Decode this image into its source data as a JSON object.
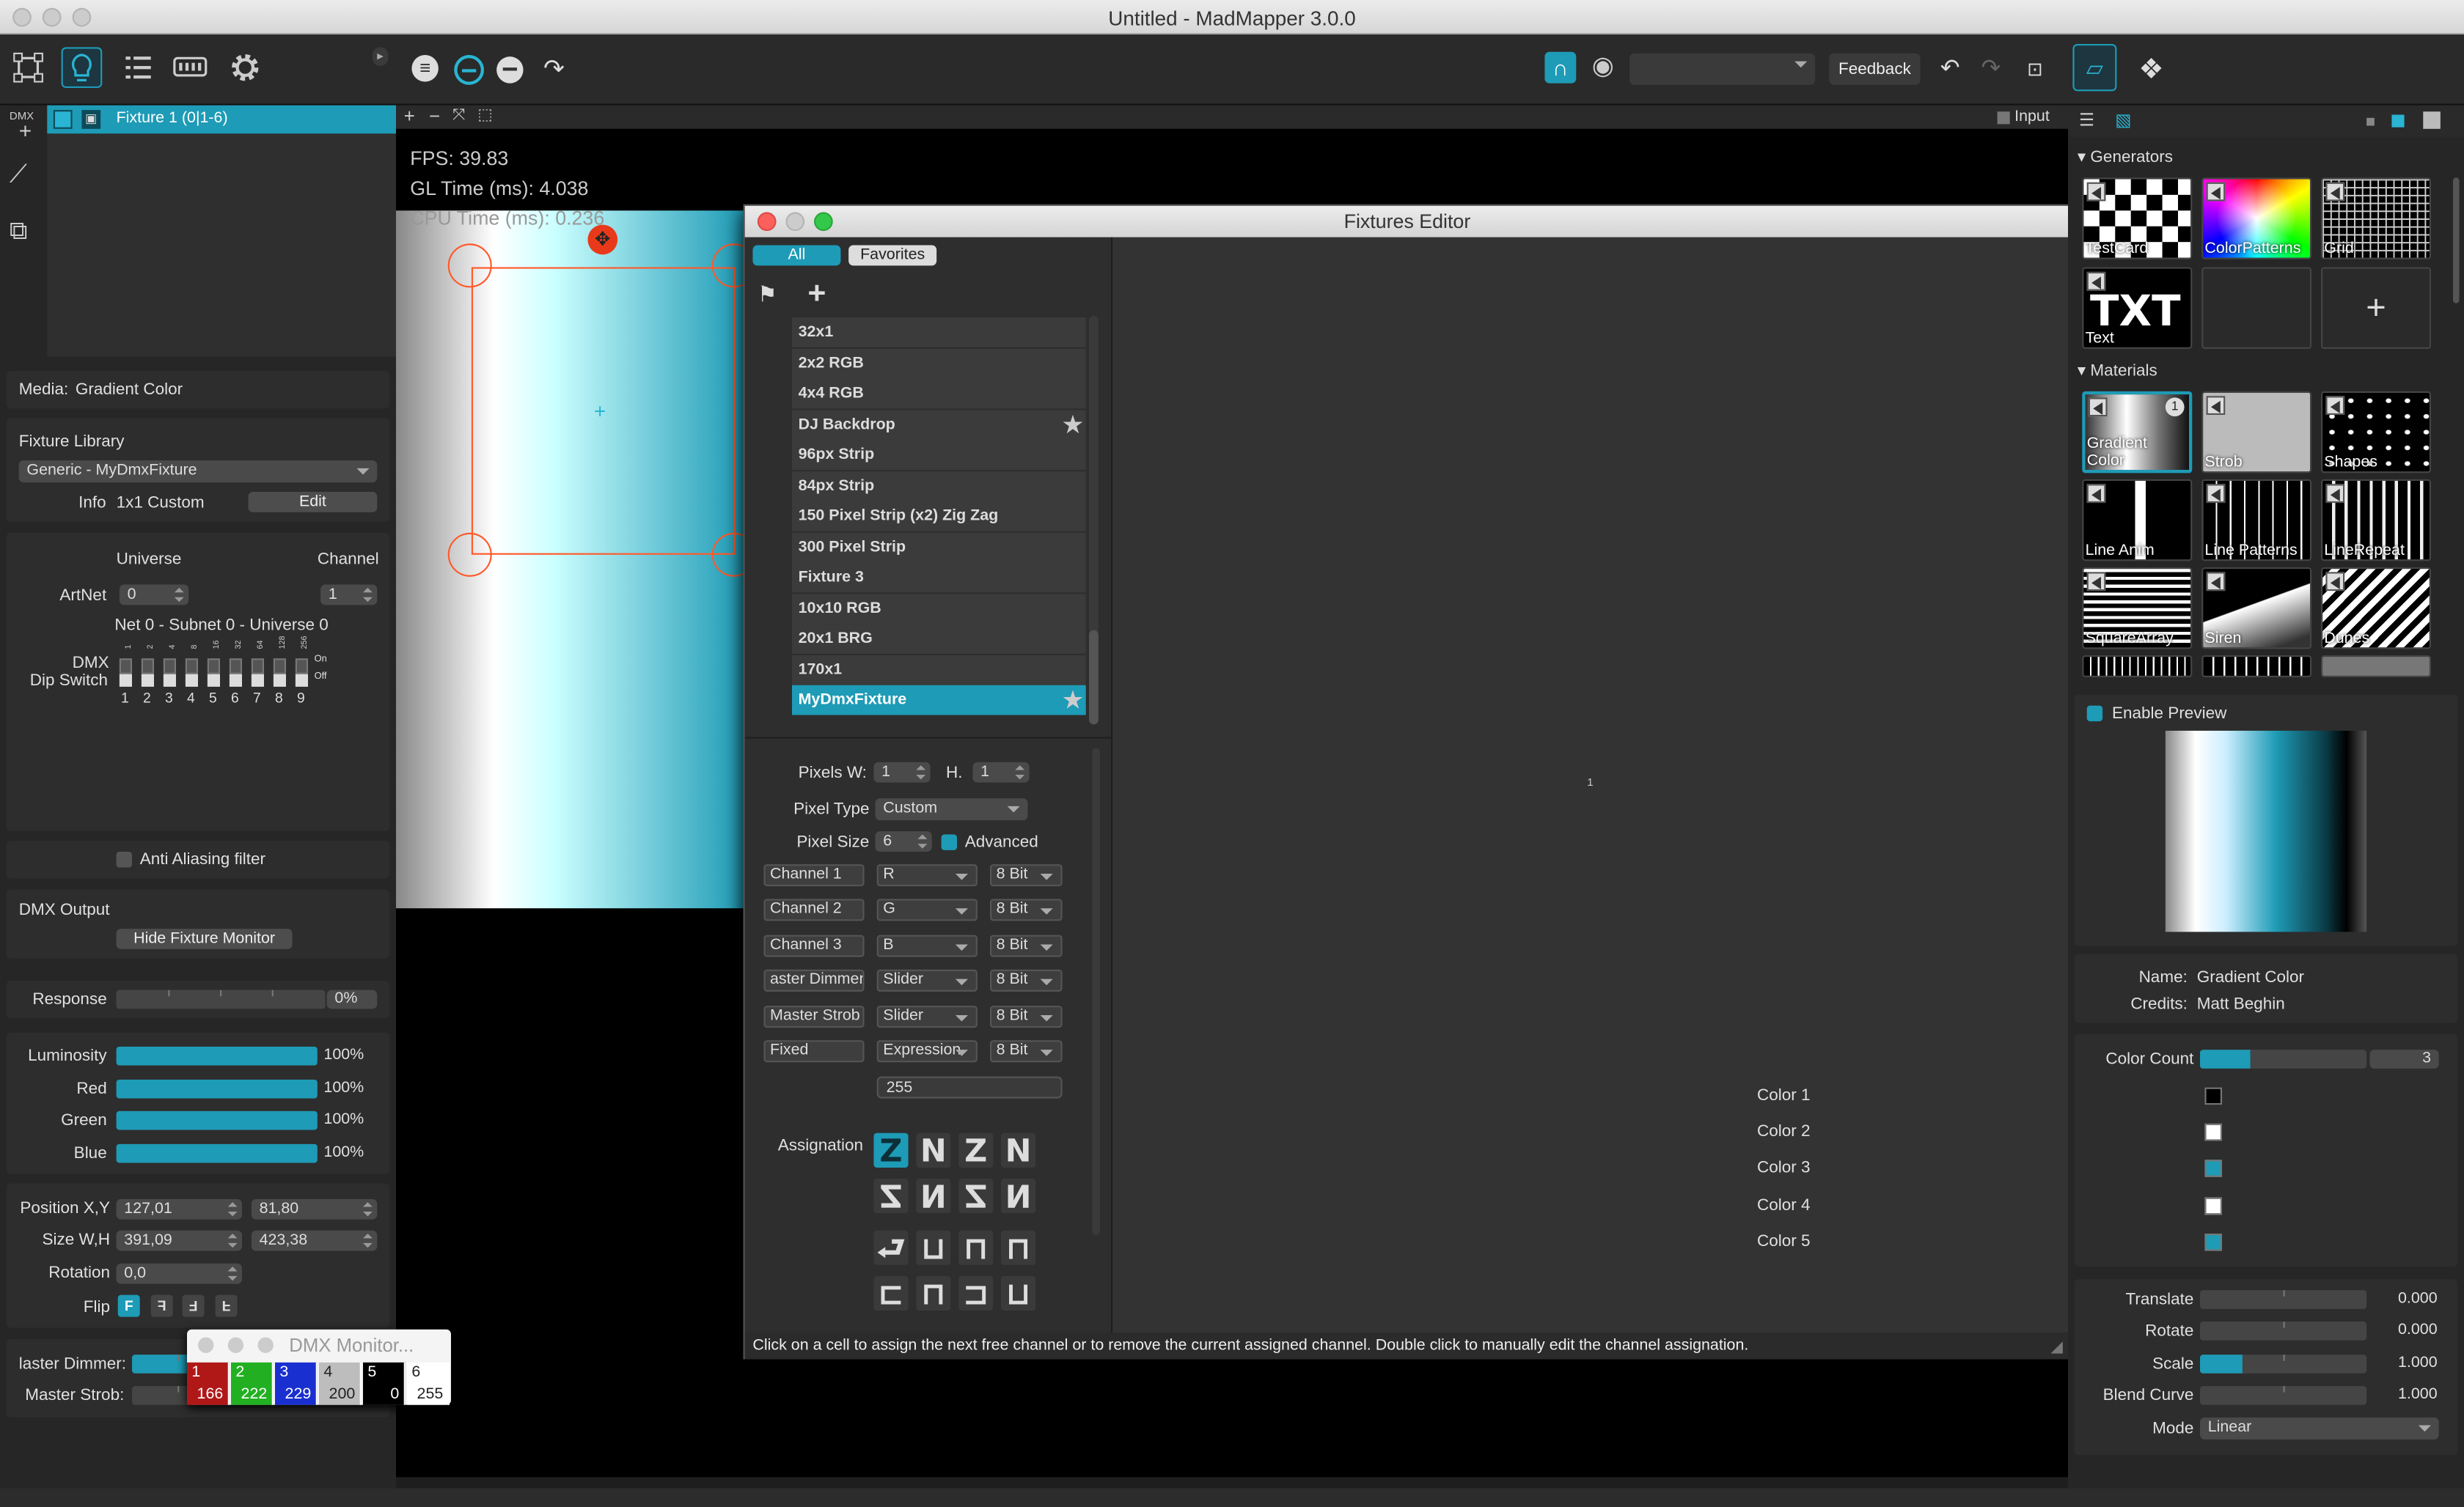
{
  "window": {
    "title": "Untitled - MadMapper 3.0.0"
  },
  "toolbar": {
    "feedback": "Feedback"
  },
  "left": {
    "fixture_label": "Fixture 1 (0|1-6)",
    "dmx_tag": "DMX",
    "media_label": "Media:",
    "media_value": "Gradient Color",
    "fixture_library": "Fixture Library",
    "library_select": "Generic - MyDmxFixture",
    "info_label": "Info",
    "info_value": "1x1 Custom",
    "edit": "Edit",
    "universe": "Universe",
    "channel": "Channel",
    "artnet": "ArtNet",
    "artnet_universe": "0",
    "artnet_channel": "1",
    "net_info": "Net 0 - Subnet 0 - Universe 0",
    "dmx": "DMX",
    "dip_switch": "Dip Switch",
    "dip_on": "On",
    "dip_off": "Off",
    "dip_top": [
      "1",
      "2",
      "4",
      "8",
      "16",
      "32",
      "64",
      "128",
      "256"
    ],
    "dip_bottom": [
      "1",
      "2",
      "3",
      "4",
      "5",
      "6",
      "7",
      "8",
      "9"
    ],
    "anti_aliasing": "Anti Aliasing filter",
    "dmx_output": "DMX Output",
    "hide_monitor": "Hide Fixture Monitor",
    "response": "Response",
    "response_value": "0%",
    "luminosity": "Luminosity",
    "luminosity_value": "100%",
    "red": "Red",
    "red_value": "100%",
    "green": "Green",
    "green_value": "100%",
    "blue": "Blue",
    "blue_value": "100%",
    "position": "Position X,Y",
    "pos_x": "127,01",
    "pos_y": "81,80",
    "size": "Size W,H",
    "size_w": "391,09",
    "size_h": "423,38",
    "rotation": "Rotation",
    "rotation_value": "0,0",
    "flip": "Flip",
    "master_dimmer": "laster Dimmer:",
    "master_dimmer_value": "200",
    "master_dimmer_fraction": 0.78,
    "master_strob": "Master Strob:",
    "master_strob_value": "0"
  },
  "stage": {
    "input": "Input",
    "fps": "FPS: 39.83",
    "gl_time": "GL Time (ms): 4.038",
    "cpu_time": "CPU Time (ms): 0.236"
  },
  "editor": {
    "title": "Fixtures Editor",
    "tab_all": "All",
    "tab_favorites": "Favorites",
    "list": [
      "32x1",
      "2x2 RGB",
      "4x4 RGB",
      "DJ Backdrop",
      "96px Strip",
      "84px Strip",
      "150 Pixel Strip (x2) Zig Zag",
      "300 Pixel Strip",
      "Fixture 3",
      "10x10 RGB",
      "20x1 BRG",
      "170x1",
      "MyDmxFixture"
    ],
    "pixels_w_label": "Pixels W:",
    "pixels_w": "1",
    "h_label": "H.",
    "pixels_h": "1",
    "pixel_type_label": "Pixel Type",
    "pixel_type": "Custom",
    "pixel_size_label": "Pixel Size",
    "pixel_size": "6",
    "advanced": "Advanced",
    "channels": [
      {
        "name": "Channel 1",
        "type": "R",
        "bits": "8 Bit"
      },
      {
        "name": "Channel 2",
        "type": "G",
        "bits": "8 Bit"
      },
      {
        "name": "Channel 3",
        "type": "B",
        "bits": "8 Bit"
      },
      {
        "name": "aster Dimmer",
        "type": "Slider",
        "bits": "8 Bit"
      },
      {
        "name": "Master Strob",
        "type": "Slider",
        "bits": "8 Bit"
      },
      {
        "name": "Fixed",
        "type": "Expression",
        "bits": "8 Bit"
      }
    ],
    "fixed_value": "255",
    "assignation": "Assignation",
    "preview_num": "1",
    "status": "Click on a cell to assign the next free channel or to remove the current assigned channel. Double click to manually edit the channel assignation."
  },
  "monitor": {
    "title": "DMX Monitor...",
    "cells": [
      {
        "ch": "1",
        "val": "166",
        "color": "#b01818"
      },
      {
        "ch": "2",
        "val": "222",
        "color": "#22b022"
      },
      {
        "ch": "3",
        "val": "229",
        "color": "#1a2fd0"
      },
      {
        "ch": "4",
        "val": "200",
        "color": "#bdbdbd"
      },
      {
        "ch": "5",
        "val": "0",
        "color": "#000000"
      },
      {
        "ch": "6",
        "val": "255",
        "color": "#ffffff"
      }
    ]
  },
  "right": {
    "generators": "Generators",
    "gen_tiles": [
      "TestCard",
      "ColorPatterns",
      "Grid",
      "Text"
    ],
    "txt": "TXT",
    "materials": "Materials",
    "mat_tiles": [
      "Gradient Color",
      "Strob",
      "Shapes",
      "Line Anim",
      "Line Patterns",
      "LineRepeat",
      "SquareArray",
      "Siren",
      "Dunes"
    ],
    "mat_badge": "1",
    "enable_preview": "Enable Preview",
    "name_label": "Name:",
    "name_value": "Gradient Color",
    "credits_label": "Credits:",
    "credits_value": "Matt Beghin",
    "color_count": "Color Count",
    "color_count_value": "3",
    "colors": [
      {
        "label": "Color 1",
        "color": "#000000"
      },
      {
        "label": "Color 2",
        "color": "#ffffff"
      },
      {
        "label": "Color 3",
        "color": "#1e9bb6"
      },
      {
        "label": "Color 4",
        "color": "#ffffff"
      },
      {
        "label": "Color 5",
        "color": "#1e9bb6"
      }
    ],
    "translate": "Translate",
    "translate_value": "0.000",
    "rotate": "Rotate",
    "rotate_value": "0.000",
    "scale": "Scale",
    "scale_value": "1.000",
    "blend_curve": "Blend Curve",
    "blend_curve_value": "1.000",
    "mode": "Mode",
    "mode_value": "Linear"
  },
  "accent": "#1e9bb6"
}
